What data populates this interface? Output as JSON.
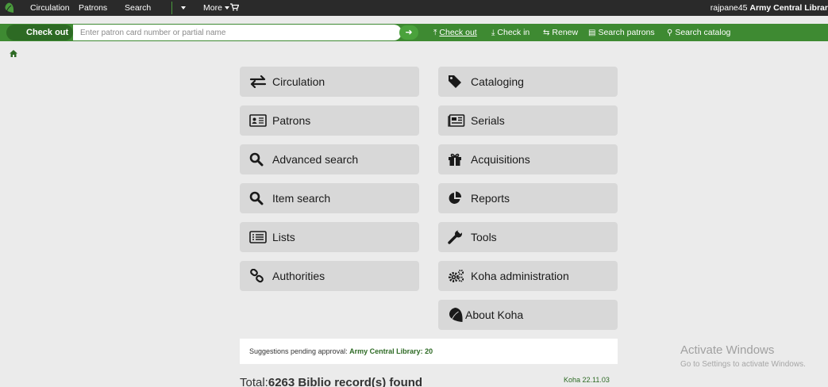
{
  "topnav": {
    "items": [
      "Circulation",
      "Patrons",
      "Search",
      "More"
    ],
    "user": "rajpane45",
    "library": "Army Central Librar"
  },
  "toolbar": {
    "checkout_label": "Check out",
    "patron_placeholder": "Enter patron card number or partial name",
    "go_icon": "arrow-right-icon",
    "tools": [
      {
        "label": "Check out",
        "icon": "upload-icon",
        "active": true
      },
      {
        "label": "Check in",
        "icon": "download-icon",
        "active": false
      },
      {
        "label": "Renew",
        "icon": "retweet-icon",
        "active": false
      },
      {
        "label": "Search patrons",
        "icon": "id-card-icon",
        "active": false
      },
      {
        "label": "Search catalog",
        "icon": "search-icon",
        "active": false
      }
    ]
  },
  "tiles": {
    "circulation": "Circulation",
    "cataloging": "Cataloging",
    "patrons": "Patrons",
    "serials": "Serials",
    "advanced_search": "Advanced search",
    "acquisitions": "Acquisitions",
    "item_search": "Item search",
    "reports": "Reports",
    "lists": "Lists",
    "tools": "Tools",
    "authorities": "Authorities",
    "koha_administration": "Koha administration",
    "about_koha": "About Koha"
  },
  "suggestions": {
    "label": "Suggestions pending approval:",
    "link": "Army Central Library: 20"
  },
  "total": {
    "prefix": "Total:",
    "value": "6263 Biblio record(s) found"
  },
  "version": "Koha 22.11.03",
  "watermark": {
    "title": "Activate Windows",
    "subtitle": "Go to Settings to activate Windows."
  },
  "colors": {
    "navbar": "#2a2a2a",
    "toolbar_green": "#3e8a32",
    "accent_green": "#2d6a24",
    "tile_bg": "#d8d8d8",
    "page_bg": "#ebebeb"
  }
}
